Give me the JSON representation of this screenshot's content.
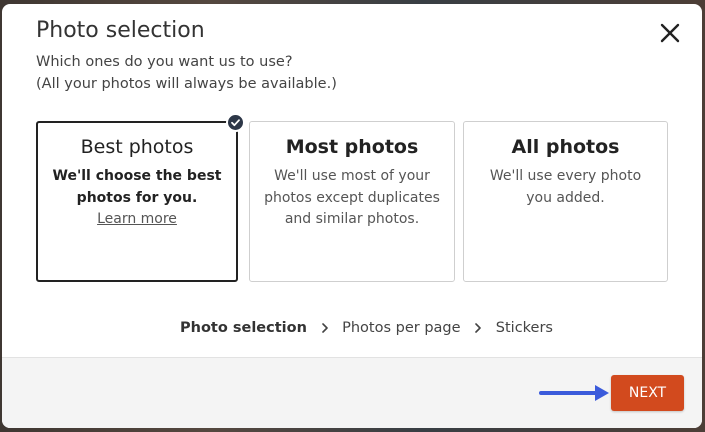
{
  "dialog": {
    "title": "Photo selection",
    "subtitle_lines": [
      "Which ones do you want us to use?",
      "(All your photos will always be available.)"
    ]
  },
  "options": [
    {
      "title": "Best photos",
      "desc_lines": [
        "We'll choose the best",
        "photos for you."
      ],
      "link": "Learn more",
      "selected": true
    },
    {
      "title": "Most photos",
      "desc_lines": [
        "We'll use most of your",
        "photos except duplicates",
        "and similar photos."
      ],
      "selected": false
    },
    {
      "title": "All photos",
      "desc_lines": [
        "We'll use every photo",
        "you added."
      ],
      "selected": false
    }
  ],
  "breadcrumb": {
    "items": [
      "Photo selection",
      "Photos per page",
      "Stickers"
    ],
    "current_index": 0
  },
  "footer": {
    "next_label": "NEXT"
  },
  "colors": {
    "accent": "#d24a1e",
    "arrow": "#3b5bdb",
    "selected_border": "#222222"
  }
}
